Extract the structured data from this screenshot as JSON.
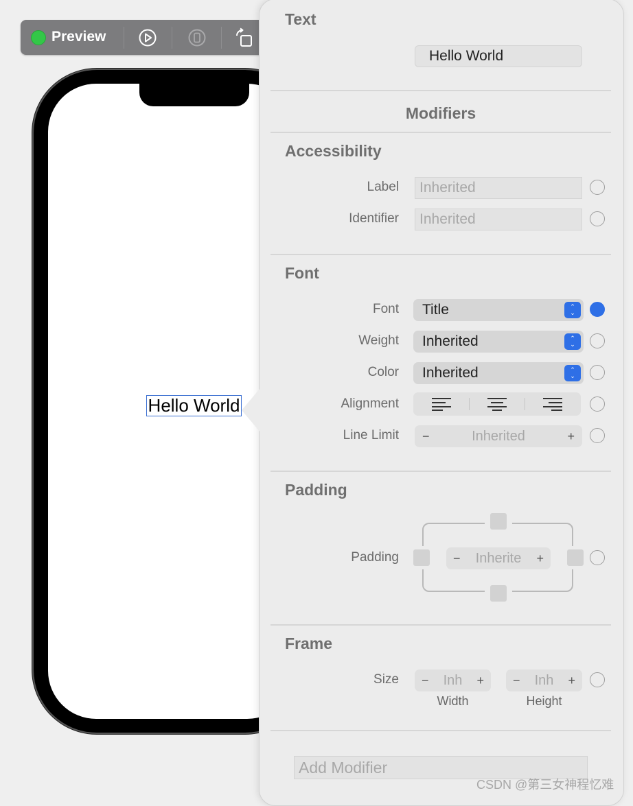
{
  "toolbar": {
    "preview_label": "Preview"
  },
  "canvas": {
    "hello_text": "Hello World"
  },
  "inspector": {
    "text_section": {
      "title": "Text",
      "value": "Hello World"
    },
    "modifiers_title": "Modifiers",
    "accessibility": {
      "title": "Accessibility",
      "label": {
        "label": "Label",
        "placeholder": "Inherited"
      },
      "identifier": {
        "label": "Identifier",
        "placeholder": "Inherited"
      }
    },
    "font": {
      "title": "Font",
      "font": {
        "label": "Font",
        "value": "Title"
      },
      "weight": {
        "label": "Weight",
        "value": "Inherited"
      },
      "color": {
        "label": "Color",
        "value": "Inherited"
      },
      "alignment": {
        "label": "Alignment"
      },
      "line_limit": {
        "label": "Line Limit",
        "value": "Inherited"
      }
    },
    "padding": {
      "title": "Padding",
      "label": "Padding",
      "value": "Inherite"
    },
    "frame": {
      "title": "Frame",
      "size_label": "Size",
      "width": {
        "value": "Inh",
        "label": "Width"
      },
      "height": {
        "value": "Inh",
        "label": "Height"
      }
    },
    "add_modifier_placeholder": "Add Modifier"
  },
  "stepper_minus": "−",
  "stepper_plus": "+",
  "watermark": "CSDN @第三女神程忆难",
  "colors": {
    "accent": "#2e6fe6",
    "status_green": "#33c748",
    "toolbar_bg": "#7c7c7e"
  }
}
